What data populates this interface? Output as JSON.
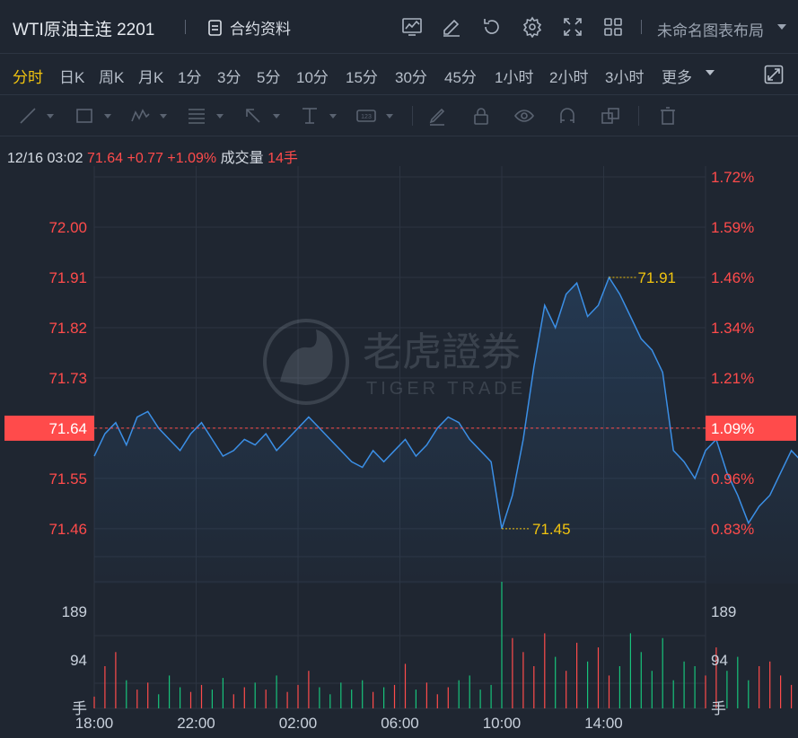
{
  "header": {
    "title": "WTI原油主连 2201",
    "contract_label": "合约资料",
    "layout_label": "未命名图表布局"
  },
  "toolbar_icons": [
    "indicator-icon",
    "edit-icon",
    "undo-icon",
    "settings-icon",
    "fullscreen-icon",
    "grid-icon"
  ],
  "periods": [
    "分时",
    "日K",
    "周K",
    "月K",
    "1分",
    "3分",
    "5分",
    "10分",
    "15分",
    "30分",
    "45分",
    "1小时",
    "2小时",
    "3小时",
    "更多"
  ],
  "active_period": "分时",
  "drawing_tools": [
    "line-tool-icon",
    "rect-tool-icon",
    "pattern-tool-icon",
    "fib-tool-icon",
    "arrow-tool-icon",
    "measure-tool-icon",
    "text-tool-icon",
    "pen-icon",
    "lock-icon",
    "eye-icon",
    "magnet-icon",
    "layers-icon",
    "trash-icon"
  ],
  "quote": {
    "time": "12/16 03:02",
    "price": "71.64",
    "change": "+0.77",
    "change_pct": "+1.09%",
    "volume_label": "成交量",
    "volume": "14手"
  },
  "watermark": {
    "cn": "老虎證券",
    "en": "TIGER TRADE"
  },
  "chart_data": {
    "type": "line",
    "price_axis": {
      "left_ticks": [
        "72.00",
        "71.91",
        "71.82",
        "71.73",
        "71.64",
        "71.55",
        "71.46"
      ],
      "right_ticks": [
        "1.72%",
        "1.59%",
        "1.46%",
        "1.34%",
        "1.21%",
        "1.09%",
        "0.96%",
        "0.83%"
      ],
      "range": [
        71.41,
        72.09
      ]
    },
    "current_price": "71.64",
    "current_pct": "1.09%",
    "high_label": "71.91",
    "low_label": "71.45",
    "time_axis": [
      "18:00",
      "22:00",
      "02:00",
      "06:00",
      "10:00",
      "14:00"
    ],
    "volume_axis": {
      "ticks": [
        "189",
        "94"
      ],
      "unit": "手",
      "max": 270
    },
    "colors": {
      "line": "#3b8fe6",
      "up": "#ff4b4b",
      "down": "#17c37b",
      "high_low": "#f1c40f",
      "grid": "#2c3441"
    },
    "series": [
      {
        "values": [
          71.59,
          71.63,
          71.65,
          71.61,
          71.66,
          71.67,
          71.64,
          71.62,
          71.6,
          71.63,
          71.65,
          71.62,
          71.59,
          71.6,
          71.62,
          71.61,
          71.63,
          71.6,
          71.62,
          71.64,
          71.66,
          71.64,
          71.62,
          71.6,
          71.58,
          71.57,
          71.6,
          71.58,
          71.6,
          71.62,
          71.59,
          71.61,
          71.64,
          71.66,
          71.65,
          71.62,
          71.6,
          71.58,
          71.46,
          71.52,
          71.62,
          71.75,
          71.86,
          71.82,
          71.88,
          71.9,
          71.84,
          71.86,
          71.91,
          71.88,
          71.84,
          71.8,
          71.78,
          71.74,
          71.6,
          71.58,
          71.55,
          71.6,
          71.62,
          71.56,
          71.52,
          71.47,
          71.5,
          71.52,
          71.56,
          71.6,
          71.58,
          71.62,
          71.57,
          71.55,
          71.58,
          71.6,
          71.62,
          71.66,
          71.7,
          71.67,
          71.64,
          71.66,
          71.68,
          71.72,
          71.7,
          71.66,
          71.68,
          71.7,
          71.67,
          71.64,
          71.62,
          71.65,
          71.63,
          71.6,
          71.62,
          71.64,
          71.6,
          71.58,
          71.56,
          71.58,
          71.6,
          71.57,
          71.56,
          71.58,
          71.56,
          71.54,
          71.53,
          71.56,
          71.55,
          71.54,
          71.56,
          71.55,
          71.56,
          71.57,
          71.55,
          71.56,
          71.58,
          71.6,
          71.62,
          71.64,
          71.66,
          71.65,
          71.63,
          71.66,
          71.68,
          71.65,
          71.62,
          71.64,
          71.66,
          71.64,
          71.66,
          71.68,
          71.7,
          71.72,
          71.74,
          71.72,
          71.7,
          71.73,
          71.76,
          71.74,
          71.71,
          71.76,
          71.8,
          71.85,
          71.83,
          71.8,
          71.84,
          71.82,
          71.78,
          71.74,
          71.76,
          71.73,
          71.7,
          71.72,
          71.66,
          71.64,
          71.6
        ]
      },
      {
        "name": "volume",
        "values": [
          25,
          90,
          120,
          60,
          40,
          55,
          30,
          70,
          45,
          35,
          50,
          40,
          65,
          30,
          45,
          55,
          40,
          70,
          35,
          50,
          80,
          45,
          30,
          55,
          40,
          60,
          35,
          45,
          50,
          95,
          40,
          55,
          30,
          45,
          60,
          70,
          40,
          50,
          270,
          150,
          120,
          90,
          160,
          110,
          80,
          140,
          100,
          130,
          70,
          90,
          160,
          120,
          80,
          150,
          60,
          100,
          90,
          70,
          130,
          80,
          110,
          60,
          90,
          100,
          70,
          50,
          80,
          60,
          90,
          70,
          50,
          60,
          70,
          80,
          55,
          70,
          90,
          60,
          50,
          70,
          80,
          45,
          60,
          70,
          50,
          65,
          40,
          55,
          60,
          70,
          45,
          50,
          40,
          60,
          50,
          45,
          55,
          35,
          45,
          50,
          40,
          35,
          45,
          30,
          40,
          50,
          35,
          45,
          55,
          40,
          50,
          60,
          70,
          45,
          55,
          80,
          60,
          120,
          70,
          55,
          90,
          75,
          65,
          50,
          110,
          60,
          85,
          70,
          55,
          90,
          70,
          60,
          50,
          80,
          70,
          45,
          60,
          90,
          55,
          70,
          50,
          60,
          45,
          55,
          40,
          60,
          50,
          55,
          40,
          60
        ]
      }
    ]
  }
}
